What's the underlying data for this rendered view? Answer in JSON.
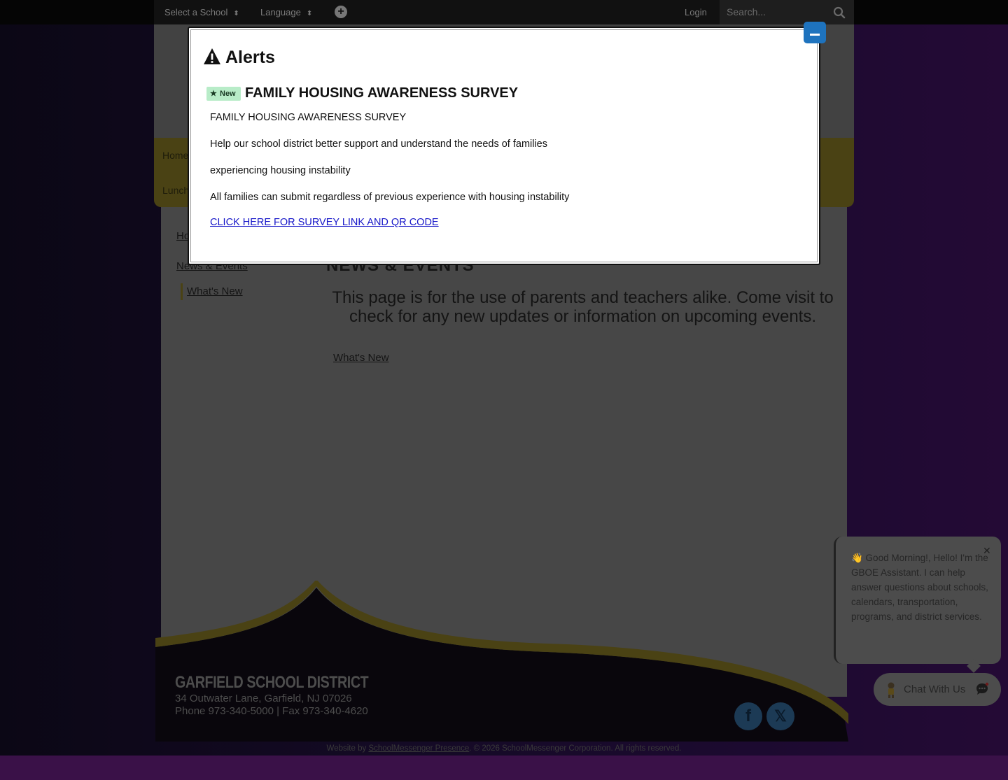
{
  "topbar": {
    "select_school": "Select a School",
    "language": "Language",
    "login": "Login",
    "search_placeholder": "Search..."
  },
  "nav": {
    "items": [
      "Home",
      "Lunch"
    ]
  },
  "sidebar": {
    "items": [
      {
        "label": "Home"
      },
      {
        "label": "News & Events"
      }
    ],
    "sub_item": "What's New"
  },
  "main": {
    "title": "NEWS & EVENTS",
    "description": "This page is for the use of parents and teachers alike. Come visit to check for any new updates or information on upcoming events.",
    "link": "What's New"
  },
  "footer": {
    "district_name": "GARFIELD SCHOOL DISTRICT",
    "address": "34 Outwater Lane, Garfield, NJ 07026",
    "phone_fax": "Phone 973-340-5000 | Fax 973-340-4620",
    "social": [
      "facebook-icon",
      "x-icon"
    ],
    "credit_prefix": "Website by",
    "credit_link": "SchoolMessenger Presence",
    "credit_suffix": ". © 2026 SchoolMessenger Corporation. All rights reserved."
  },
  "chat": {
    "message": "👋 Good Morning!, Hello! I'm the GBOE Assistant. I can help answer questions about schools, calendars, transportation, programs, and district services.",
    "close": "✕",
    "button_label": "Chat With Us"
  },
  "alerts": {
    "header": "Alerts",
    "badge": "New",
    "alert_title": "FAMILY HOUSING AWARENESS SURVEY",
    "lines": [
      "FAMILY HOUSING AWARENESS SURVEY",
      "Help our school district better support and understand the needs of families",
      "experiencing housing instability",
      "All families can submit regardless of previous experience with housing instability"
    ],
    "link": "CLICK HERE FOR SURVEY LINK AND QR CODE"
  },
  "colors": {
    "accent_gold": "#f2d61b",
    "modal_link": "#1515c8",
    "minimize_button": "#1e73be",
    "badge_bg": "#b8ecc8"
  }
}
